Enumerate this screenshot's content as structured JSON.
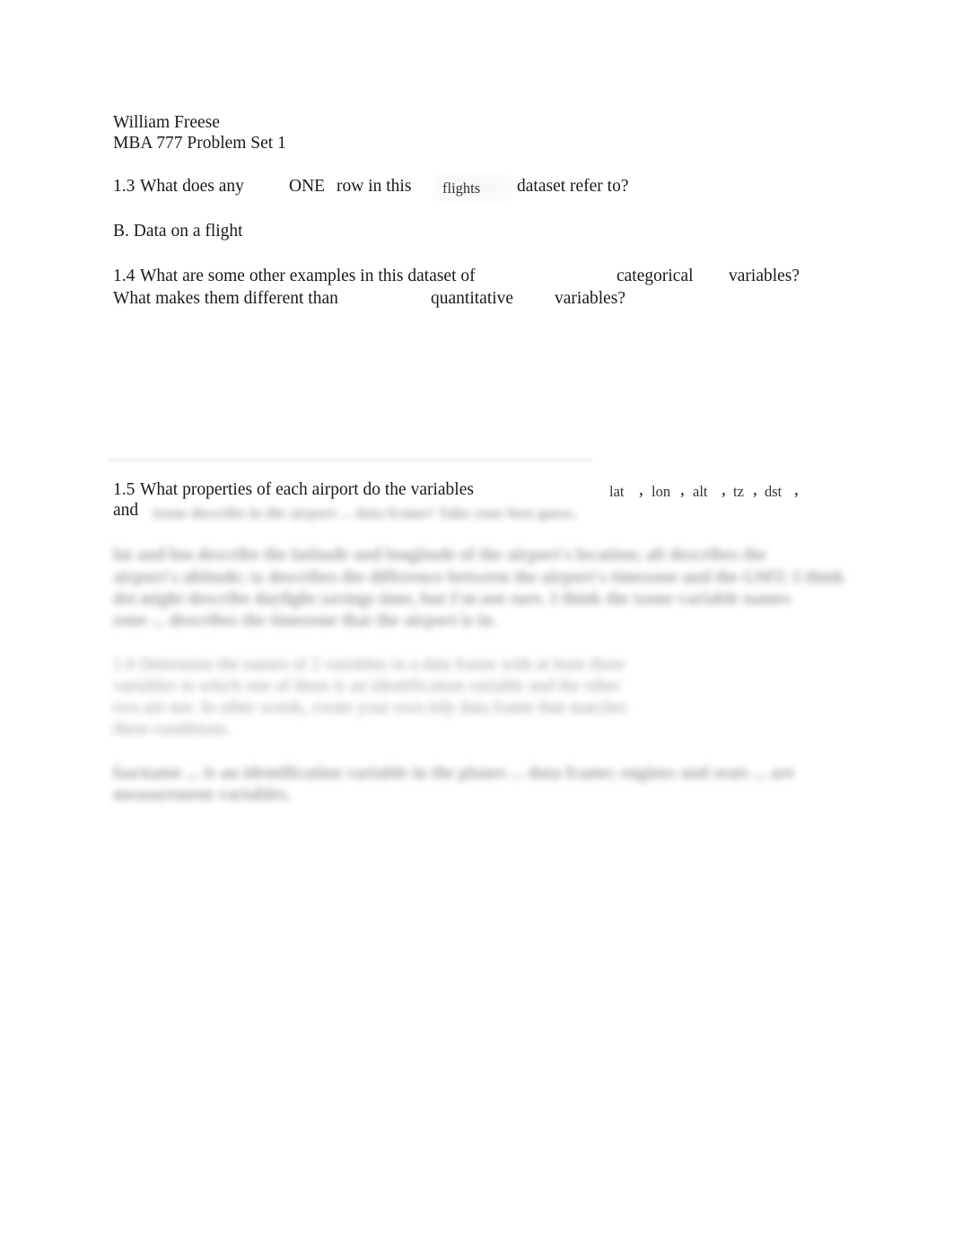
{
  "header": {
    "author": "William Freese",
    "course": "MBA 777 Problem Set 1"
  },
  "q13": {
    "number": "1.3",
    "text_a": "What does any",
    "emphasis": "ONE",
    "text_b": "row in this",
    "code": "flights",
    "text_c": "dataset refer to?"
  },
  "a13": {
    "answer": "B. Data on a flight"
  },
  "q14": {
    "number": "1.4",
    "line1_text": "What are some other examples in this dataset of",
    "line1_term": "categorical",
    "line1_end": "variables?",
    "line2_text": "What makes them different than",
    "line2_term": "quantitative",
    "line2_end": "variables?"
  },
  "q15": {
    "number": "1.5",
    "text": "What properties of each airport do the variables",
    "variables": [
      "lat",
      "lon",
      "alt",
      "tz",
      "dst"
    ],
    "separator": ",",
    "and_label": "and",
    "obscured_rest": "tzone describe in the airport ... data frame? Take your best guess."
  },
  "obscured_sections": [
    "lat and lon describe the latitude and longitude of the airport's location; alt describes the",
    "airport's altitude; tz describes the difference between the airport's timezone and the GMT; I think",
    "dst might describe daylight savings time, but I'm not sure. I think the tzone variable names",
    "zone ... describes the timezone that the airport is in.",
    "1.6 Determine the names of 2 variables in a data frame with at least three",
    "variables in which one of them is an identification variable and the other",
    "two are not. In other words, create your own tidy data frame that matches",
    "these conditions.",
    "faa/name ... is an identification variable in the planes ... data frame; engines and seats ... are",
    "measurement variables."
  ]
}
